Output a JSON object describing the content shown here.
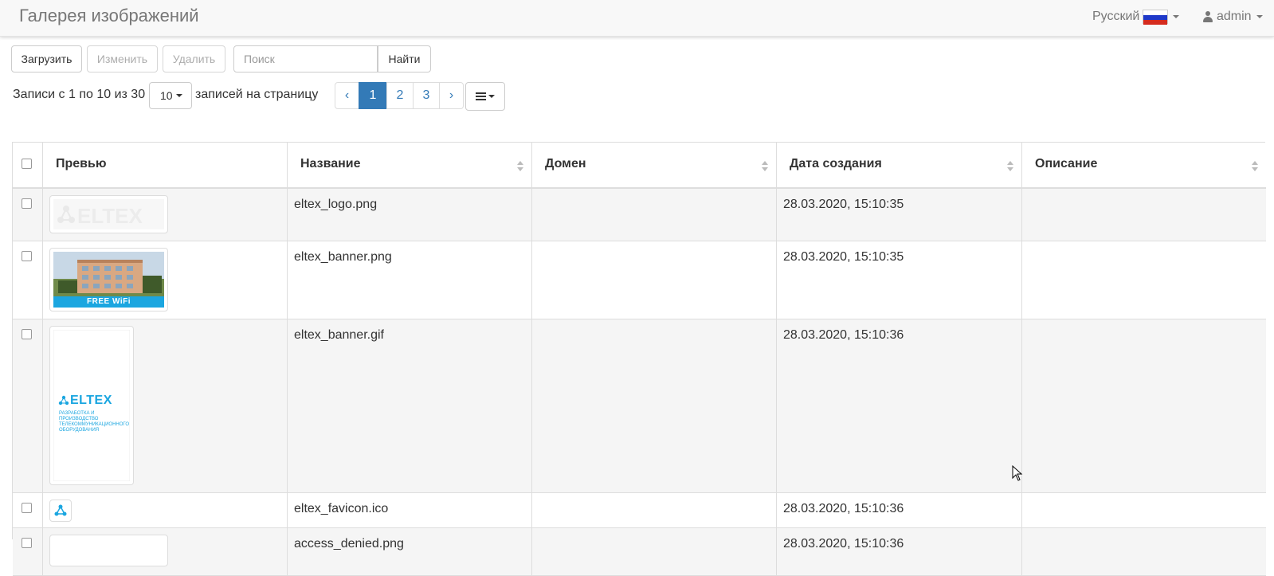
{
  "header": {
    "title": "Галерея изображений",
    "language": "Русский",
    "user": "admin"
  },
  "toolbar": {
    "upload": "Загрузить",
    "edit": "Изменить",
    "delete": "Удалить",
    "search_placeholder": "Поиск",
    "find": "Найти"
  },
  "paging": {
    "records_info": "Записи с 1 по 10 из 30",
    "page_size": "10",
    "per_page_label": "записей на страницу",
    "prev": "‹",
    "pages": [
      "1",
      "2",
      "3"
    ],
    "next": "›",
    "active_page": "1"
  },
  "table": {
    "columns": [
      "Превью",
      "Название",
      "Домен",
      "Дата создания",
      "Описание"
    ],
    "rows": [
      {
        "name": "eltex_logo.png",
        "domain": "",
        "created": "28.03.2020, 15:10:35",
        "description": "",
        "preview": "eltex-logo-thumbnail"
      },
      {
        "name": "eltex_banner.png",
        "domain": "",
        "created": "28.03.2020, 15:10:35",
        "description": "",
        "preview": "building-banner-thumbnail",
        "preview_caption": "FREE WiFi"
      },
      {
        "name": "eltex_banner.gif",
        "domain": "",
        "created": "28.03.2020, 15:10:36",
        "description": "",
        "preview": "eltex-vertical-banner-thumbnail",
        "preview_logo": "ELTEX",
        "preview_caption": "РАЗРАБОТКА И ПРОИЗВОДСТВО ТЕЛЕКОММУНИКАЦИОННОГО ОБОРУДОВАНИЯ"
      },
      {
        "name": "eltex_favicon.ico",
        "domain": "",
        "created": "28.03.2020, 15:10:36",
        "description": "",
        "preview": "eltex-favicon-thumbnail"
      },
      {
        "name": "access_denied.png",
        "domain": "",
        "created": "28.03.2020, 15:10:36",
        "description": "",
        "preview": "access-denied-thumbnail"
      }
    ]
  },
  "colors": {
    "accent": "#337ab7",
    "navbar_bg": "#f8f8f8",
    "stripe": "#f5f5f5",
    "eltex_blue": "#1ba6e0"
  }
}
